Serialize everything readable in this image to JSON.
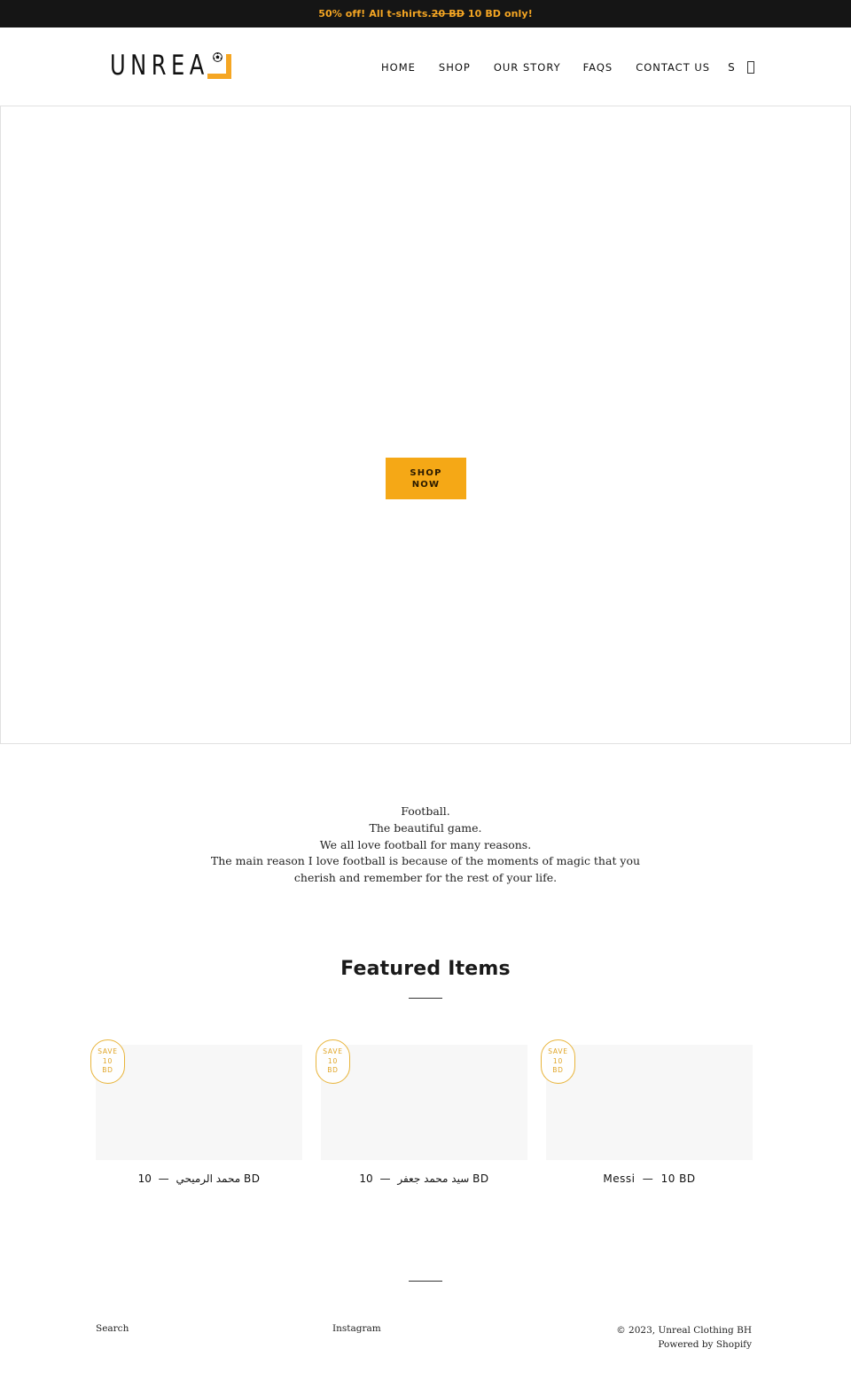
{
  "announcement": {
    "lead": "50% off! All t-shirts.",
    "old_price": "20 BD",
    "new_price": " 10 BD only!",
    "color": "#f5a623"
  },
  "header": {
    "logo_text": "UNREA",
    "logo_accent_color": "#f5a623",
    "nav": [
      {
        "label": "HOME"
      },
      {
        "label": "SHOP"
      },
      {
        "label": "OUR STORY"
      },
      {
        "label": "FAQS"
      },
      {
        "label": "CONTACT US"
      }
    ],
    "search_label": "S",
    "cart_icon": "cart-icon"
  },
  "hero": {
    "button_line1": "SHOP",
    "button_line2": "NOW",
    "button_color": "#f5a816"
  },
  "intro": {
    "lines": [
      "Football.",
      "The beautiful game.",
      "We all love football for many reasons.",
      "The main reason I love football is because of the moments of magic that you",
      "cherish and remember for the rest of your life."
    ]
  },
  "featured": {
    "title": "Featured Items",
    "products": [
      {
        "badge": [
          "SAVE",
          "10",
          "BD"
        ],
        "name": "محمد الرميحي",
        "dash": "—",
        "price": "10 BD"
      },
      {
        "badge": [
          "SAVE",
          "10",
          "BD"
        ],
        "name": "سيد محمد جعفر",
        "dash": "—",
        "price": "10 BD"
      },
      {
        "badge": [
          "SAVE",
          "10",
          "BD"
        ],
        "name": "Messi",
        "dash": "—",
        "price": "10 BD"
      }
    ]
  },
  "footer": {
    "search": "Search",
    "instagram": "Instagram",
    "copyright": "© 2023, Unreal Clothing BH",
    "powered": "Powered by Shopify"
  }
}
